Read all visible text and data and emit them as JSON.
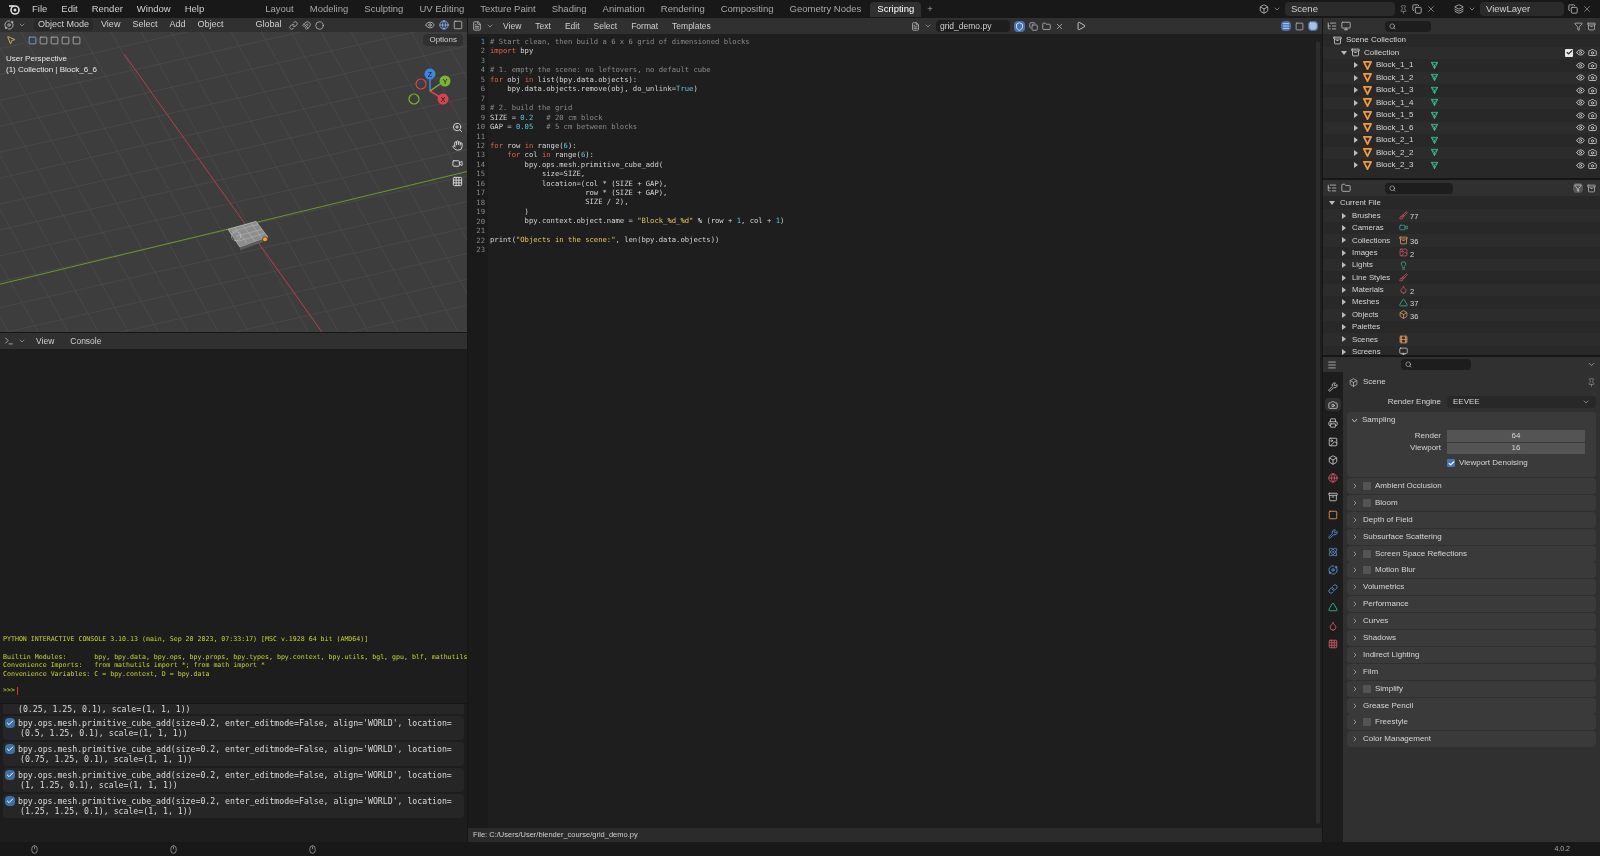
{
  "topbar": {
    "menus": [
      "File",
      "Edit",
      "Render",
      "Window",
      "Help"
    ],
    "workspaces": [
      {
        "label": "Layout",
        "selected": false
      },
      {
        "label": "Modeling",
        "selected": false
      },
      {
        "label": "Sculpting",
        "selected": false
      },
      {
        "label": "UV Editing",
        "selected": false
      },
      {
        "label": "Texture Paint",
        "selected": false
      },
      {
        "label": "Shading",
        "selected": false
      },
      {
        "label": "Animation",
        "selected": false
      },
      {
        "label": "Rendering",
        "selected": false
      },
      {
        "label": "Compositing",
        "selected": false
      },
      {
        "label": "Geometry Nodes",
        "selected": false
      },
      {
        "label": "Scripting",
        "selected": true
      }
    ],
    "add_tab": "+",
    "scene": "Scene",
    "view_layer": "ViewLayer"
  },
  "viewport": {
    "mode": "Object Mode",
    "menus": [
      "View",
      "Select",
      "Add",
      "Object"
    ],
    "orientation": "Global",
    "options": "Options",
    "view_name": "User Perspective",
    "context": "(1) Collection | Block_6_6",
    "gizmo": {
      "x": "X",
      "y": "Y",
      "z": "Z"
    }
  },
  "console": {
    "menus": [
      "View",
      "Console"
    ],
    "lines": [
      "PYTHON INTERACTIVE CONSOLE 3.10.13 (main, Sep 20 2023, 07:33:17) [MSC v.1928 64 bit (AMD64)]",
      "Builtin Modules:       bpy, bpy.data, bpy.ops, bpy.props, bpy.types, bpy.context, bpy.utils, bgl, gpu, blf, mathutils",
      "Convenience Imports:   from mathutils import *; from math import *",
      "Convenience Variables: C = bpy.context, D = bpy.data"
    ],
    "prompt": ">>>"
  },
  "info_log": {
    "partial": "(0.25, 1.25, 0.1), scale=(1, 1, 1))",
    "entries": [
      {
        "lines": [
          "bpy.ops.mesh.primitive_cube_add(size=0.2, enter_editmode=False, align='WORLD', location=",
          "(0.5, 1.25, 0.1), scale=(1, 1, 1))"
        ]
      },
      {
        "lines": [
          "bpy.ops.mesh.primitive_cube_add(size=0.2, enter_editmode=False, align='WORLD', location=",
          "(0.75, 1.25, 0.1), scale=(1, 1, 1))"
        ]
      },
      {
        "lines": [
          "bpy.ops.mesh.primitive_cube_add(size=0.2, enter_editmode=False, align='WORLD', location=",
          "(1, 1.25, 0.1), scale=(1, 1, 1))"
        ]
      },
      {
        "lines": [
          "bpy.ops.mesh.primitive_cube_add(size=0.2, enter_editmode=False, align='WORLD', location=",
          "(1.25, 1.25, 0.1), scale=(1, 1, 1))"
        ]
      }
    ]
  },
  "text_editor": {
    "menus": [
      "View",
      "Text",
      "Edit",
      "Select",
      "Format",
      "Templates"
    ],
    "file_name": "grid_demo.py",
    "lines": [
      {
        "number": "1",
        "segments": [
          {
            "text": "# Start clean, then build a 6 x 6 grid of dimensioned blocks",
            "kind": "comment"
          }
        ]
      },
      {
        "number": "2",
        "segments": [
          {
            "text": "import",
            "kind": "keyword"
          },
          {
            "text": " bpy",
            "kind": "plain"
          }
        ]
      },
      {
        "number": "3"
      },
      {
        "number": "4",
        "segments": [
          {
            "text": "# 1. empty the scene: no leftovers, no default cube",
            "kind": "comment"
          }
        ]
      },
      {
        "number": "5",
        "segments": [
          {
            "text": "for",
            "kind": "keyword"
          },
          {
            "text": " obj ",
            "kind": "plain"
          },
          {
            "text": "in",
            "kind": "keyword"
          },
          {
            "text": " list(bpy.data.objects):",
            "kind": "plain"
          }
        ]
      },
      {
        "number": "6",
        "segments": [
          {
            "text": "    bpy.data.objects.remove(obj, do_unlink=",
            "kind": "plain"
          },
          {
            "text": "True",
            "kind": "number"
          },
          {
            "text": ")",
            "kind": "plain"
          }
        ]
      },
      {
        "number": "7"
      },
      {
        "number": "8",
        "segments": [
          {
            "text": "# 2. build the grid",
            "kind": "comment"
          }
        ]
      },
      {
        "number": "9",
        "segments": [
          {
            "text": "SIZE = ",
            "kind": "plain"
          },
          {
            "text": "0.2",
            "kind": "number"
          },
          {
            "text": "   # 20 cm block",
            "kind": "comment"
          }
        ]
      },
      {
        "number": "10",
        "segments": [
          {
            "text": "GAP = ",
            "kind": "plain"
          },
          {
            "text": "0.05",
            "kind": "number"
          },
          {
            "text": "   # 5 cm between blocks",
            "kind": "comment"
          }
        ]
      },
      {
        "number": "11"
      },
      {
        "number": "12",
        "segments": [
          {
            "text": "for",
            "kind": "keyword"
          },
          {
            "text": " row ",
            "kind": "plain"
          },
          {
            "text": "in",
            "kind": "keyword"
          },
          {
            "text": " range(",
            "kind": "plain"
          },
          {
            "text": "6",
            "kind": "number"
          },
          {
            "text": "):",
            "kind": "plain"
          }
        ]
      },
      {
        "number": "13",
        "segments": [
          {
            "text": "    for",
            "kind": "keyword"
          },
          {
            "text": " col ",
            "kind": "plain"
          },
          {
            "text": "in",
            "kind": "keyword"
          },
          {
            "text": " range(",
            "kind": "plain"
          },
          {
            "text": "6",
            "kind": "number"
          },
          {
            "text": "):",
            "kind": "plain"
          }
        ]
      },
      {
        "number": "14",
        "segments": [
          {
            "text": "        bpy.ops.mesh.primitive_cube_add(",
            "kind": "plain"
          }
        ]
      },
      {
        "number": "15",
        "segments": [
          {
            "text": "            size=SIZE,",
            "kind": "plain"
          }
        ]
      },
      {
        "number": "16",
        "segments": [
          {
            "text": "            location=(col * (SIZE + GAP),",
            "kind": "plain"
          }
        ]
      },
      {
        "number": "17",
        "segments": [
          {
            "text": "                      row * (SIZE + GAP),",
            "kind": "plain"
          }
        ]
      },
      {
        "number": "18",
        "segments": [
          {
            "text": "                      SIZE / 2),",
            "kind": "plain"
          }
        ]
      },
      {
        "number": "19",
        "segments": [
          {
            "text": "        )",
            "kind": "plain"
          }
        ]
      },
      {
        "number": "20",
        "segments": [
          {
            "text": "        bpy.context.object.name = ",
            "kind": "plain"
          },
          {
            "text": "\"Block_%d_%d\"",
            "kind": "string"
          },
          {
            "text": " % (row + ",
            "kind": "plain"
          },
          {
            "text": "1",
            "kind": "number"
          },
          {
            "text": ", col + ",
            "kind": "plain"
          },
          {
            "text": "1",
            "kind": "number"
          },
          {
            "text": ")",
            "kind": "plain"
          }
        ]
      },
      {
        "number": "21"
      },
      {
        "number": "22",
        "segments": [
          {
            "text": "print(",
            "kind": "plain"
          },
          {
            "text": "\"Objects in the scene:\"",
            "kind": "string"
          },
          {
            "text": ", len(bpy.data.objects))",
            "kind": "plain"
          }
        ]
      },
      {
        "number": "23"
      }
    ],
    "footer": "File: C:/Users/User/blender_course/grid_demo.py"
  },
  "outliner": {
    "root": "Scene Collection",
    "collection": {
      "name": "Collection",
      "checked": true,
      "expanded": true,
      "children": [
        {
          "name": "Block_1_1",
          "expanded": false
        },
        {
          "name": "Block_1_2",
          "expanded": false
        },
        {
          "name": "Block_1_3",
          "expanded": false
        },
        {
          "name": "Block_1_4",
          "expanded": false
        },
        {
          "name": "Block_1_5",
          "expanded": false
        },
        {
          "name": "Block_1_6",
          "expanded": false
        },
        {
          "name": "Block_2_1",
          "expanded": false
        },
        {
          "name": "Block_2_2",
          "expanded": false
        },
        {
          "name": "Block_2_3",
          "expanded": false
        }
      ]
    }
  },
  "file_outliner": {
    "root": "Current File",
    "expanded": true,
    "items": [
      {
        "name": "Brushes",
        "kind": "brush",
        "count": "77",
        "expanded": false
      },
      {
        "name": "Cameras",
        "kind": "camera",
        "expanded": false
      },
      {
        "name": "Collections",
        "kind": "collection",
        "count": "36",
        "expanded": false
      },
      {
        "name": "Images",
        "kind": "image",
        "count": "2",
        "expanded": false
      },
      {
        "name": "Lights",
        "kind": "light",
        "expanded": false
      },
      {
        "name": "Line Styles",
        "kind": "linestyle",
        "expanded": false
      },
      {
        "name": "Materials",
        "kind": "material",
        "count": "2",
        "expanded": false
      },
      {
        "name": "Meshes",
        "kind": "mesh",
        "count": "37",
        "expanded": false
      },
      {
        "name": "Objects",
        "kind": "object",
        "count": "36",
        "expanded": false
      },
      {
        "name": "Palettes",
        "kind": "none",
        "expanded": false
      },
      {
        "name": "Scenes",
        "kind": "scene",
        "expanded": false
      },
      {
        "name": "Screens",
        "kind": "screen",
        "expanded": false
      }
    ]
  },
  "properties": {
    "tabs": [
      {
        "kind": "tool",
        "selected": false
      },
      {
        "kind": "render",
        "selected": true
      },
      {
        "kind": "output",
        "selected": false
      },
      {
        "kind": "view_layer",
        "selected": false
      },
      {
        "kind": "scene",
        "selected": false
      },
      {
        "kind": "world",
        "selected": false
      },
      {
        "kind": "collection",
        "selected": false
      },
      {
        "kind": "object",
        "selected": false
      },
      {
        "kind": "modifier",
        "selected": false
      },
      {
        "kind": "particles",
        "selected": false
      },
      {
        "kind": "physics",
        "selected": false
      },
      {
        "kind": "constraints",
        "selected": false
      },
      {
        "kind": "data",
        "selected": false
      },
      {
        "kind": "material",
        "selected": false
      },
      {
        "kind": "texture",
        "selected": false
      }
    ],
    "header": "Scene",
    "render_engine": {
      "label": "Render Engine",
      "value": "EEVEE"
    },
    "sampling": {
      "title": "Sampling",
      "expanded": true,
      "fields": [
        {
          "label": "Render",
          "value": "64"
        },
        {
          "label": "Viewport",
          "value": "16"
        }
      ],
      "denoising": {
        "label": "Viewport Denoising",
        "checked": true
      }
    },
    "panels": [
      {
        "title": "Ambient Occlusion",
        "kind": "toggle",
        "checked": false
      },
      {
        "title": "Bloom",
        "kind": "toggle",
        "checked": false
      },
      {
        "title": "Depth of Field",
        "kind": "plain"
      },
      {
        "title": "Subsurface Scattering",
        "kind": "plain"
      },
      {
        "title": "Screen Space Reflections",
        "kind": "toggle",
        "checked": false
      },
      {
        "title": "Motion Blur",
        "kind": "toggle",
        "checked": false
      },
      {
        "title": "Volumetrics",
        "kind": "plain"
      },
      {
        "title": "Performance",
        "kind": "plain"
      },
      {
        "title": "Curves",
        "kind": "plain"
      },
      {
        "title": "Shadows",
        "kind": "plain"
      },
      {
        "title": "Indirect Lighting",
        "kind": "plain"
      },
      {
        "title": "Film",
        "kind": "plain"
      },
      {
        "title": "Simplify",
        "kind": "toggle",
        "checked": false
      },
      {
        "title": "Grease Pencil",
        "kind": "plain"
      },
      {
        "title": "Freestyle",
        "kind": "toggle",
        "checked": false
      },
      {
        "title": "Color Management",
        "kind": "plain"
      }
    ]
  },
  "status_bar": {
    "version": "4.0.2"
  }
}
